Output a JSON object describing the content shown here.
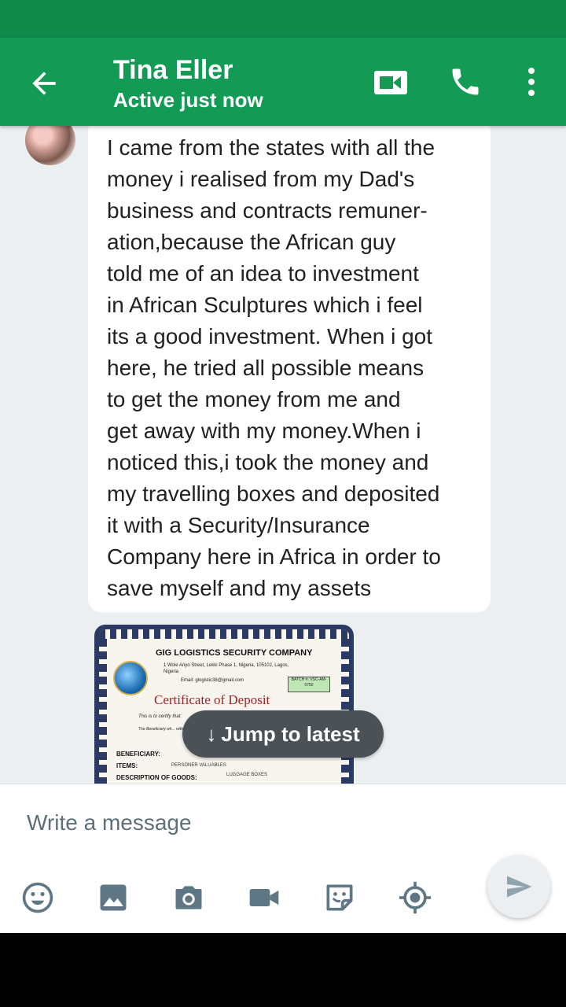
{
  "header": {
    "contact_name": "Tina Eller",
    "status": "Active just now"
  },
  "message": {
    "text": "I came from the states with all the\nmoney i realised from my Dad's\nbusiness and contracts remuner-\nation,because the African guy\ntold me of an idea to investment\nin African Sculptures which i feel\nits a good investment. When i got\nhere, he tried all possible means\nto get the money from me and\nget away with my money.When i\nnoticed this,i took the money and\nmy travelling boxes and deposited\nit with a Security/Insurance\nCompany here in Africa in order to\nsave myself and my assets"
  },
  "certificate": {
    "company": "GIG LOGISTICS SECURITY COMPANY",
    "address": "1 Wole Ariyo Street, Lekki Phase 1, Nigeria, 105102, Lagos, Nigeria",
    "email": "Email: glogistic38@gmail.com",
    "batch": "BATCH #: VSC-AM-0750",
    "title": "Certificate of Deposit",
    "certify": "This is to certify that:",
    "beneficiary_note": "The Beneficiary wh... with us. Please you a...",
    "beneficiary_label": "BENEFICIARY:",
    "items_label": "ITEMS:",
    "items_value": "PERSONER VALUABLES",
    "description_label": "DESCRIPTION OF GOODS:",
    "description_value": "LUGGAGE BOXES"
  },
  "jump_button": {
    "label": "Jump to latest",
    "icon": "arrow-down-icon"
  },
  "composer": {
    "placeholder": "Write a message",
    "tools": [
      "emoji-icon",
      "image-icon",
      "camera-icon",
      "video-icon",
      "sticker-icon",
      "location-icon"
    ]
  },
  "colors": {
    "statusbar": "#0f8a4b",
    "appbar": "#139b55",
    "chat_bg": "#eceff1",
    "bubble": "#ffffff",
    "icon_gray": "#5f7785"
  }
}
